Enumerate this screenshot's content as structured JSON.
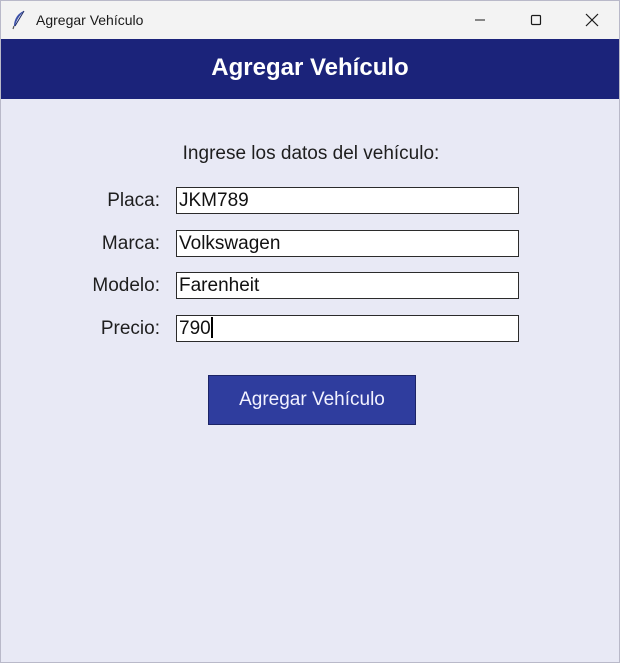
{
  "window": {
    "title": "Agregar Vehículo",
    "icon": "feather-icon",
    "controls": [
      "minimize-icon",
      "maximize-icon",
      "close-icon"
    ]
  },
  "header": {
    "title": "Agregar Vehículo",
    "background": "#1b237a"
  },
  "form": {
    "instructions": "Ingrese los datos del vehículo:",
    "fields": [
      {
        "label": "Placa:",
        "value": "JKM789"
      },
      {
        "label": "Marca:",
        "value": "Volkswagen"
      },
      {
        "label": "Modelo:",
        "value": "Farenheit"
      },
      {
        "label": "Precio:",
        "value": "790"
      }
    ],
    "submit_label": "Agregar Vehículo",
    "button_color": "#2f3d9e"
  },
  "colors": {
    "background": "#e8e9f5",
    "header": "#1b237a",
    "button": "#2f3d9e"
  }
}
